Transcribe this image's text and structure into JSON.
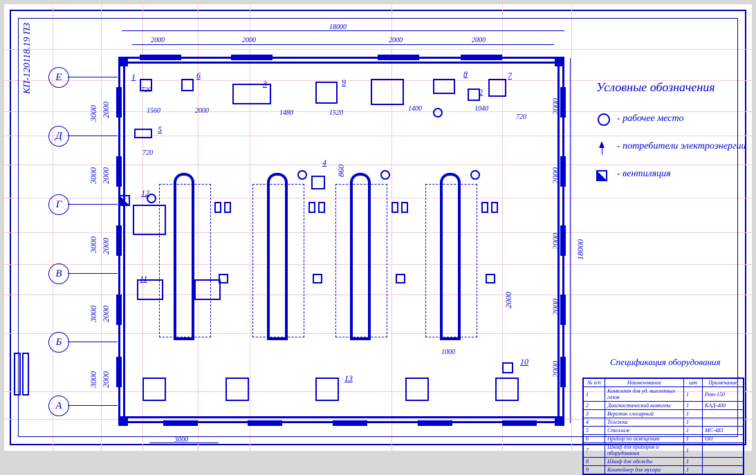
{
  "doc_code": "КП-120118.19 ПЗ",
  "legend": {
    "title": "Условные обозначения",
    "items": [
      {
        "label": "- рабочее место",
        "icon": "circle-icon"
      },
      {
        "label": "- потребители электроэнергии",
        "icon": "arrow-icon"
      },
      {
        "label": "- вентиляция",
        "icon": "vent-icon"
      }
    ]
  },
  "spec": {
    "title": "Спецификация оборудования",
    "headers": [
      "№ п/п",
      "Наименование",
      "шт",
      "Примечание"
    ],
    "rows": [
      [
        "1",
        "Комплект для уд. выхлопных газов",
        "1",
        "Рот-150"
      ],
      [
        "2",
        "Диагностический комплекс",
        "1",
        "КАД-400"
      ],
      [
        "3",
        "Верстак слесарный",
        "1",
        ""
      ],
      [
        "4",
        "Тележка",
        "1",
        ""
      ],
      [
        "5",
        "Стеллаж",
        "1",
        "МС-483"
      ],
      [
        "6",
        "Прибор по освещению",
        "1",
        "ОП"
      ],
      [
        "7",
        "Шкаф для приборов и оборудования",
        "1",
        ""
      ],
      [
        "8",
        "Шкаф для одежды",
        "1",
        ""
      ],
      [
        "9",
        "Контейнер для мусора",
        "1",
        ""
      ]
    ]
  },
  "axes": [
    "А",
    "Б",
    "В",
    "Г",
    "Д",
    "Е"
  ],
  "overall_dim": {
    "width": "18000",
    "height": "18000"
  },
  "top_gaps": [
    "2000",
    "2000",
    "2000",
    "2000"
  ],
  "left_row_spans": [
    "3000",
    "3000",
    "3000",
    "3000",
    "3000"
  ],
  "left_gate_spans": [
    "2000",
    "2000",
    "2000",
    "2000",
    "2000"
  ],
  "right_gate_spans": [
    "2000",
    "2000",
    "2000",
    "2000",
    "2000"
  ],
  "dims": {
    "d1": "720",
    "d2": "1560",
    "d3": "2000",
    "d4": "1480",
    "d5": "1520",
    "d6": "1400",
    "d7": "1040",
    "d8": "720",
    "d9": "720",
    "d10": "860",
    "d11": "2000",
    "d12": "1000",
    "d13": "3000"
  },
  "labels": {
    "n1": "1",
    "n2": "2",
    "n3": "3",
    "n4": "4",
    "n5": "5",
    "n6": "6",
    "n7": "7",
    "n8": "8",
    "n9": "9",
    "n10": "10",
    "n11": "11",
    "n12": "12",
    "n13": "13"
  }
}
